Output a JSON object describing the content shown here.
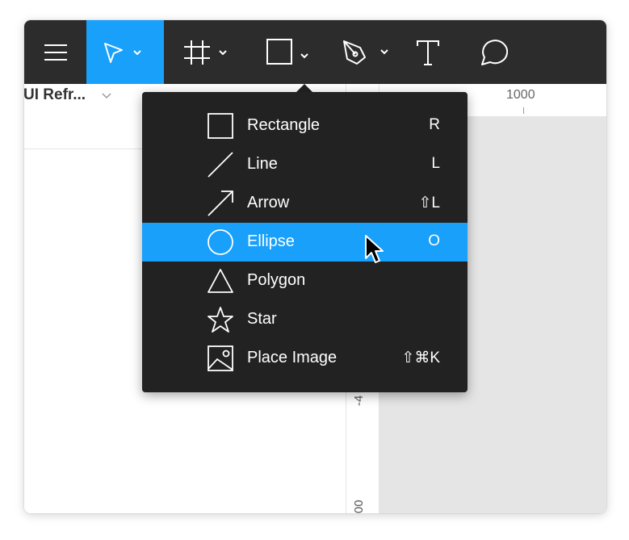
{
  "toolbar": {
    "tools": [
      {
        "name": "main-menu",
        "icon": "hamburger-icon"
      },
      {
        "name": "move-tool",
        "icon": "cursor-arrow-icon",
        "active": true
      },
      {
        "name": "frame-tool",
        "icon": "frame-hash-icon"
      },
      {
        "name": "shape-tool",
        "icon": "square-icon"
      },
      {
        "name": "pen-tool",
        "icon": "pen-icon"
      },
      {
        "name": "text-tool",
        "icon": "text-t-icon"
      },
      {
        "name": "comment-tool",
        "icon": "comment-bubble-icon"
      }
    ],
    "accent_color": "#18a0fb",
    "background_color": "#2c2c2c"
  },
  "file": {
    "title": "UI Refr..."
  },
  "rulers": {
    "horizontal_label": "1000",
    "vertical_label_1": "-4",
    "vertical_label_2": "00"
  },
  "shape_menu": {
    "items": [
      {
        "label": "Rectangle",
        "shortcut": "R",
        "icon": "rectangle-icon",
        "highlighted": false
      },
      {
        "label": "Line",
        "shortcut": "L",
        "icon": "line-icon",
        "highlighted": false
      },
      {
        "label": "Arrow",
        "shortcut": "⇧L",
        "icon": "arrow-icon",
        "highlighted": false
      },
      {
        "label": "Ellipse",
        "shortcut": "O",
        "icon": "ellipse-icon",
        "highlighted": true
      },
      {
        "label": "Polygon",
        "shortcut": "",
        "icon": "polygon-icon",
        "highlighted": false
      },
      {
        "label": "Star",
        "shortcut": "",
        "icon": "star-icon",
        "highlighted": false
      },
      {
        "label": "Place Image",
        "shortcut": "⇧⌘K",
        "icon": "image-icon",
        "highlighted": false
      }
    ],
    "highlight_color": "#18a0fb",
    "background_color": "#222222"
  }
}
